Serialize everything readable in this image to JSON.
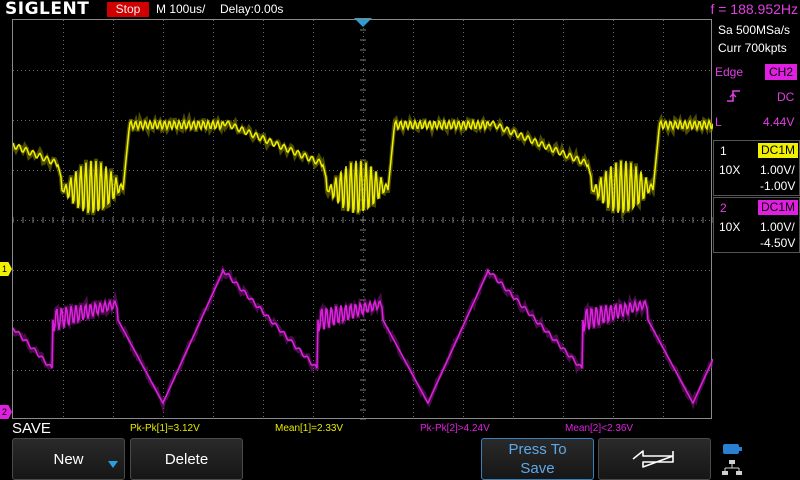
{
  "header": {
    "brand": "SIGLENT",
    "run_state": "Stop",
    "timebase": "M 100us/",
    "delay": "Delay:0.00s",
    "frequency": "f = 188.952Hz"
  },
  "acquisition": {
    "sample_rate": "Sa 500MSa/s",
    "memory": "Curr 700kpts"
  },
  "trigger": {
    "type": "Edge",
    "source": "CH2",
    "coupling": "DC",
    "level_label": "L",
    "level": "4.44V",
    "slope_icon": "rising-edge-icon"
  },
  "channels": [
    {
      "number": "1",
      "coupling": "DC1M",
      "probe": "10X",
      "scale": "1.00V/",
      "offset": "-1.00V",
      "color": "#f0f000"
    },
    {
      "number": "2",
      "coupling": "DC1M",
      "probe": "10X",
      "scale": "1.00V/",
      "offset": "-4.50V",
      "color": "#e020e0"
    }
  ],
  "markers": {
    "ch1": "1",
    "ch2": "2"
  },
  "menu_title": "SAVE",
  "measurements": [
    {
      "text": "Pk-Pk[1]=3.12V",
      "color": "#e8e800"
    },
    {
      "text": "Mean[1]=2.33V",
      "color": "#e8e800"
    },
    {
      "text": "Pk-Pk[2]>4.24V",
      "color": "#e020e0"
    },
    {
      "text": "Mean[2]<2.36V",
      "color": "#e020e0"
    }
  ],
  "softkeys": {
    "new": "New",
    "delete": "Delete",
    "press_line1": "Press To",
    "press_line2": "Save",
    "back_icon": "return-arrow-icon",
    "status_icons": [
      "usb-storage-icon",
      "network-icon"
    ]
  },
  "colors": {
    "ch1": "#f0f000",
    "ch2": "#e020e0",
    "trigger_marker": "#2aa0d8",
    "run_stop": "#d00000",
    "frequency": "#e040e0"
  }
}
